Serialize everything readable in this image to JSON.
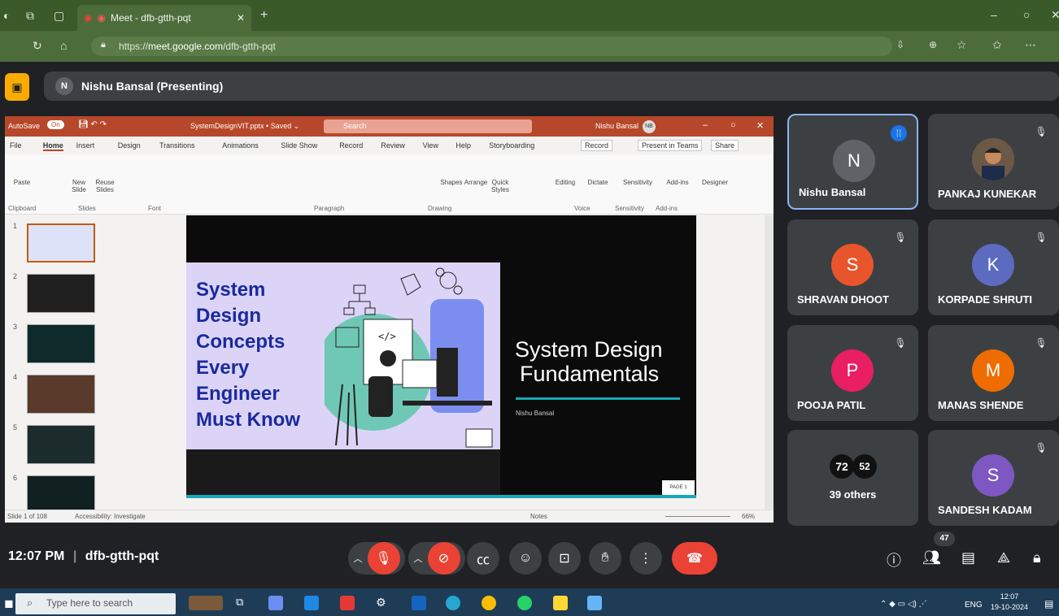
{
  "browser": {
    "tab_title": "Meet - dfb-gtth-pqt",
    "url_prefix": "https://",
    "url_domain": "meet.google.com",
    "url_path": "/dfb-gtth-pqt"
  },
  "meet": {
    "presenting_initial": "N",
    "presenting_label": "Nishu Bansal (Presenting)",
    "time": "12:07 PM",
    "meeting_code": "dfb-gtth-pqt",
    "participant_count": "47"
  },
  "ppt": {
    "title_bar": "SystemDesignVIT.pptx • Saved ⌄",
    "search": "Search",
    "user": "Nishu Bansal",
    "user_initials": "NB",
    "autosave": "AutoSave",
    "autosave_state": "On",
    "tabs": [
      "File",
      "Home",
      "Insert",
      "Design",
      "Transitions",
      "Animations",
      "Slide Show",
      "Record",
      "Review",
      "View",
      "Help",
      "Storyboarding"
    ],
    "record_btn": "Record",
    "present_btn": "Present in Teams",
    "share_btn": "Share",
    "ribbon_groups": [
      "Clipboard",
      "Slides",
      "Font",
      "Paragraph",
      "Drawing",
      "Voice",
      "Sensitivity",
      "Add-ins"
    ],
    "ribbon_items": [
      "Paste",
      "New Slide",
      "Reuse Slides",
      "Shapes",
      "Arrange",
      "Quick Styles",
      "Editing",
      "Dictate",
      "Sensitivity",
      "Add-ins",
      "Designer"
    ],
    "slide_left_title": [
      "System",
      "Design",
      "Concepts",
      "Every",
      "Engineer",
      "Must Know"
    ],
    "slide_main_title": [
      "System Design",
      "Fundamentals"
    ],
    "slide_author": "Nishu Bansal",
    "slide_page": "PAGE 1",
    "status_left": "Slide 1 of 108",
    "status_access": "Accessibility: Investigate",
    "status_notes": "Notes",
    "zoom": "66%",
    "thumb_numbers": [
      "1",
      "2",
      "3",
      "4",
      "5",
      "6"
    ]
  },
  "participants": [
    {
      "name": "Nishu Bansal",
      "initial": "N",
      "color": "#5f6368",
      "active": true
    },
    {
      "name": "PANKAJ KUNEKAR",
      "initial": "",
      "color": "#c58a3e",
      "photo": true
    },
    {
      "name": "SHRAVAN DHOOT",
      "initial": "S",
      "color": "#e8552c"
    },
    {
      "name": "KORPADE SHRUTI",
      "initial": "K",
      "color": "#5c6bc0"
    },
    {
      "name": "POOJA PATIL",
      "initial": "P",
      "color": "#e91e63"
    },
    {
      "name": "MANAS SHENDE",
      "initial": "M",
      "color": "#ef6c00"
    },
    {
      "name": "SANDESH KADAM",
      "initial": "S",
      "color": "#7e57c2"
    }
  ],
  "others": {
    "label": "39 others",
    "badge1": "72",
    "badge2": "52"
  },
  "taskbar": {
    "search_placeholder": "Type here to search",
    "lang": "ENG",
    "time": "12:07",
    "date": "19-10-2024"
  }
}
